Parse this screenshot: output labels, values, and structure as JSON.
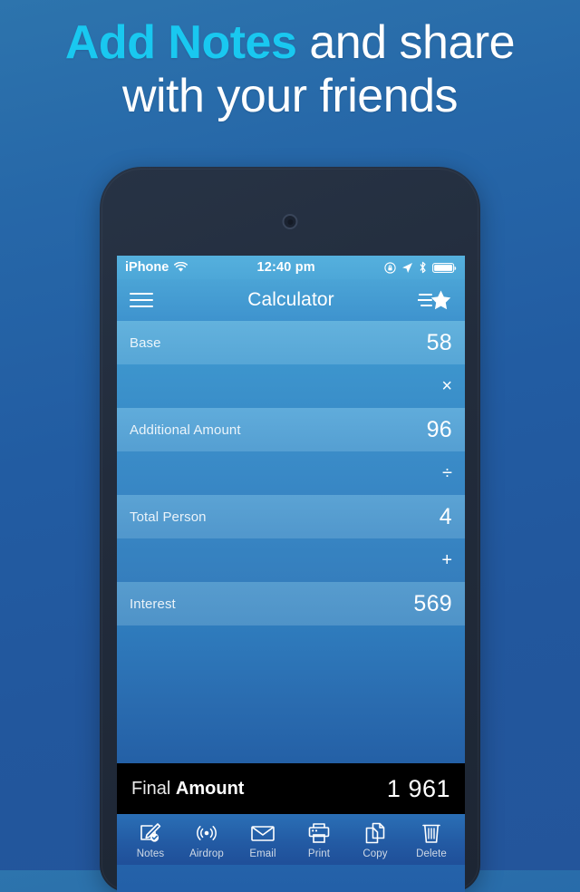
{
  "headline": {
    "accent": "Add Notes",
    "rest": " and share",
    "line2": "with your friends",
    "accent_color": "#19c8f0"
  },
  "phone": {
    "status_bar": {
      "carrier": "iPhone",
      "wifi_icon": "wifi-icon",
      "time": "12:40 pm",
      "rotation_lock_icon": "rotation-lock-icon",
      "location_icon": "location-arrow-icon",
      "bluetooth_icon": "bluetooth-icon",
      "battery_icon": "battery-full-icon"
    },
    "nav_bar": {
      "menu_icon": "hamburger-menu-icon",
      "title": "Calculator",
      "favorite_icon": "star-shooting-icon"
    },
    "calculator": {
      "rows": [
        {
          "type": "value",
          "label": "Base",
          "value": "58"
        },
        {
          "type": "operator",
          "label": "",
          "value": "×"
        },
        {
          "type": "value",
          "label": "Additional Amount",
          "value": "96"
        },
        {
          "type": "operator",
          "label": "",
          "value": "÷"
        },
        {
          "type": "value",
          "label": "Total Person",
          "value": "4"
        },
        {
          "type": "operator",
          "label": "",
          "value": "+"
        },
        {
          "type": "value",
          "label": "Interest",
          "value": "569"
        }
      ],
      "final": {
        "label_light": "Final ",
        "label_bold": "Amount",
        "value": "1 961"
      }
    },
    "toolbar": {
      "items": [
        {
          "label": "Notes",
          "icon": "notes-pencil-check-icon"
        },
        {
          "label": "Airdrop",
          "icon": "airdrop-icon"
        },
        {
          "label": "Email",
          "icon": "envelope-icon"
        },
        {
          "label": "Print",
          "icon": "printer-icon"
        },
        {
          "label": "Copy",
          "icon": "copy-pages-icon"
        },
        {
          "label": "Delete",
          "icon": "trash-icon"
        }
      ]
    }
  }
}
